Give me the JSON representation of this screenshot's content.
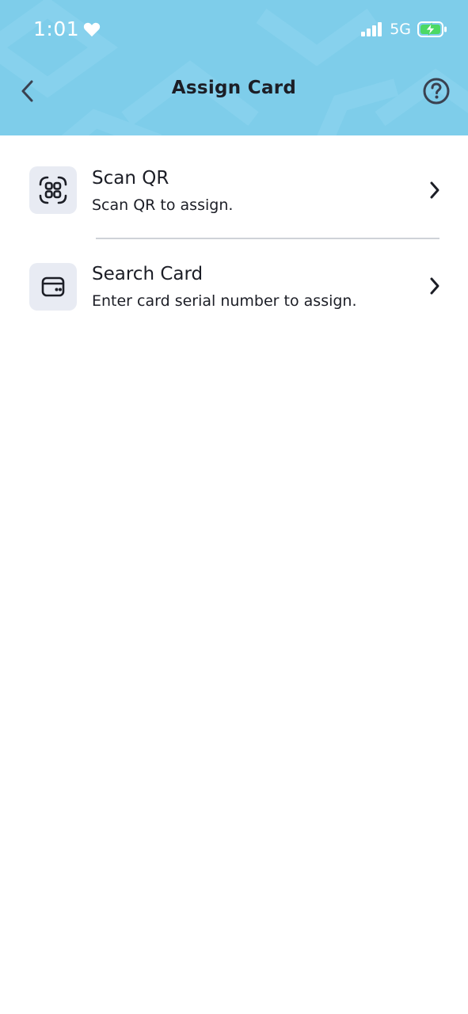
{
  "status_bar": {
    "time": "1:01",
    "network": "5G"
  },
  "header": {
    "title": "Assign Card"
  },
  "menu": {
    "items": [
      {
        "title": "Scan QR",
        "subtitle": "Scan QR to assign.",
        "icon": "qr-scan-icon"
      },
      {
        "title": "Search Card",
        "subtitle": "Enter card serial number to assign.",
        "icon": "card-icon"
      }
    ]
  },
  "colors": {
    "header_bg": "#7ecdea",
    "icon_tile_bg": "#e8ebf3",
    "text": "#1c1e26",
    "battery_fill": "#4cd964"
  }
}
